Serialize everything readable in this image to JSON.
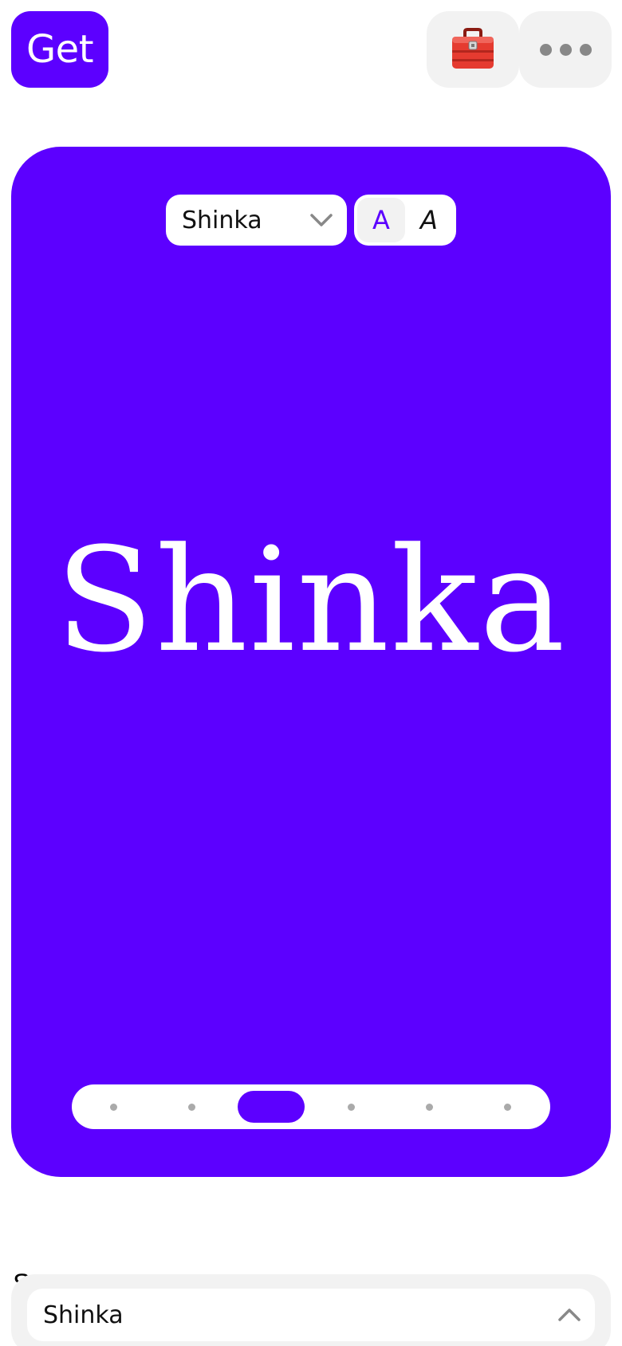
{
  "header": {
    "get_label": "Get",
    "toolbox_icon": "toolbox-icon",
    "more_icon": "more-horizontal-icon"
  },
  "preview": {
    "background_color": "#5c00ff",
    "font_select": {
      "selected": "Shinka"
    },
    "style_toggle": {
      "regular": "A",
      "italic": "A",
      "active": "regular"
    },
    "specimen_text": "Shinka",
    "pager": {
      "count": 6,
      "active_index": 2
    }
  },
  "bottom_panel": {
    "peek_text": "S",
    "select": {
      "selected": "Shinka"
    }
  },
  "colors": {
    "accent": "#5c00ff",
    "surface": "#f2f2f2",
    "muted_icon": "#888888"
  }
}
